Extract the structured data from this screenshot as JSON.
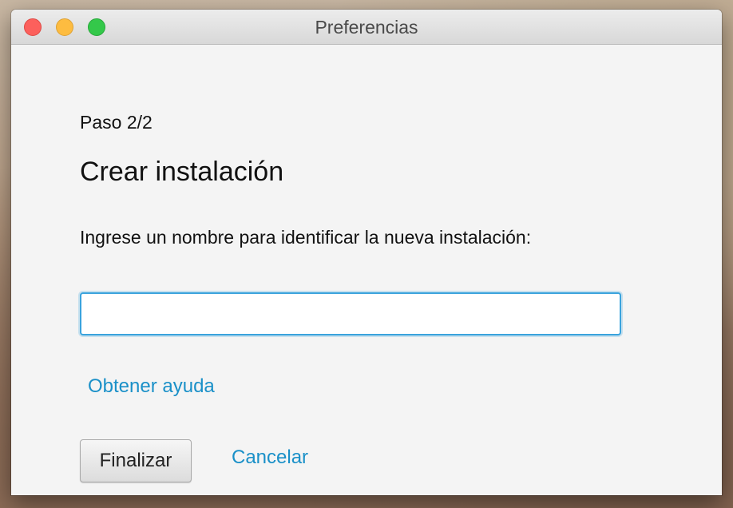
{
  "window": {
    "title": "Preferencias"
  },
  "wizard": {
    "step_label": "Paso 2/2",
    "heading": "Crear instalación",
    "prompt": "Ingrese un nombre para identificar la nueva instalación:",
    "name_input": {
      "value": "",
      "placeholder": ""
    },
    "help_link": "Obtener ayuda",
    "finish_button": "Finalizar",
    "cancel_link": "Cancelar"
  },
  "colors": {
    "accent": "#1a90c8",
    "focus_ring": "#3aa3dd",
    "close": "#fc605c",
    "minimize": "#fdbc40",
    "zoom": "#34c84a"
  }
}
